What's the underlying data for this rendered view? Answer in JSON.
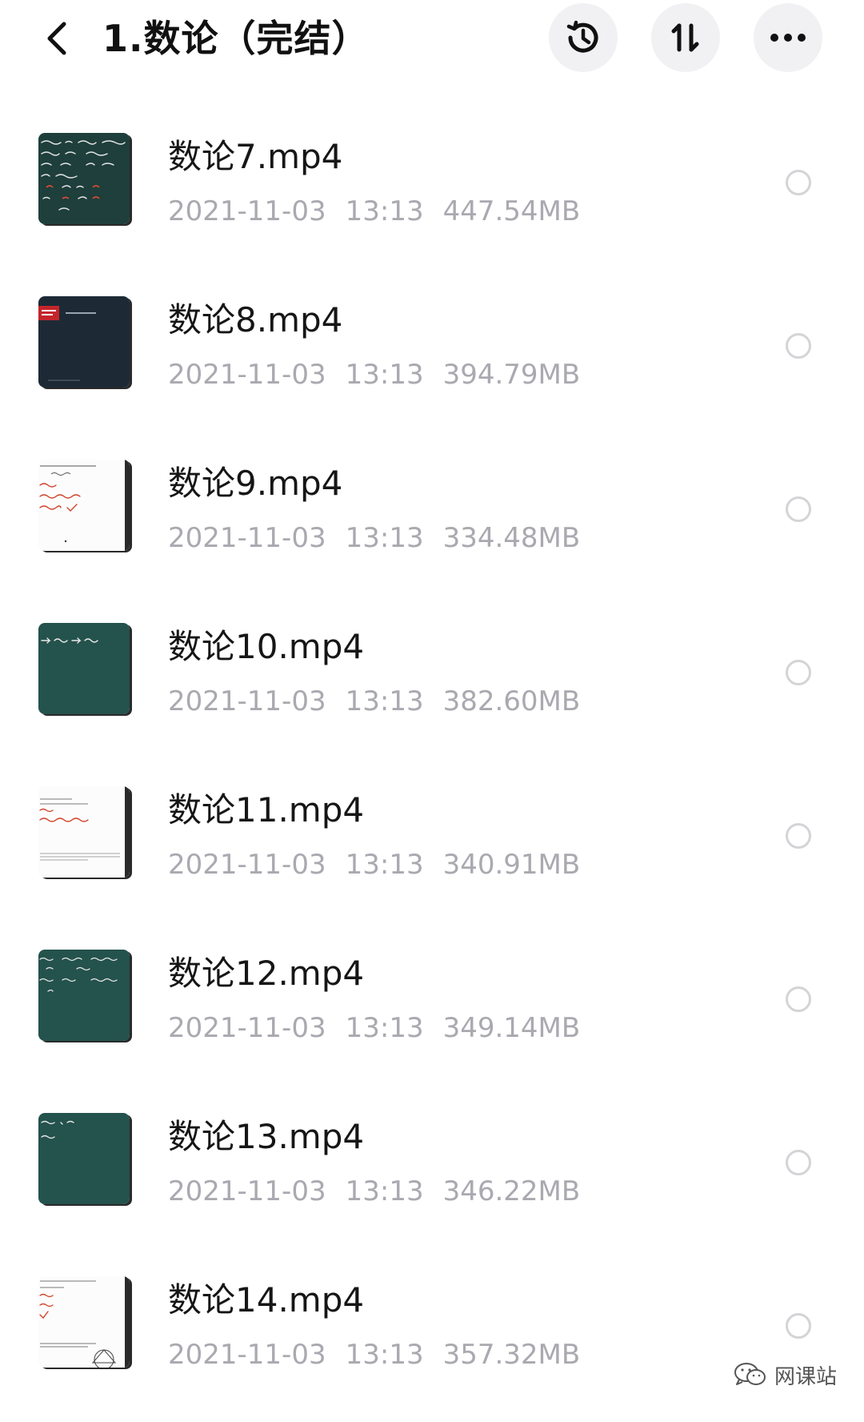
{
  "header": {
    "title": "1.数论（完结）",
    "icons": [
      "back-chevron-icon",
      "history-clock-icon",
      "sort-arrows-icon",
      "more-dots-icon"
    ]
  },
  "files": [
    {
      "name": "数论7.mp4",
      "date": "2021-11-03",
      "time": "13:13",
      "size": "447.54MB",
      "thumb": "chalkboard-dark"
    },
    {
      "name": "数论8.mp4",
      "date": "2021-11-03",
      "time": "13:13",
      "size": "394.79MB",
      "thumb": "title-slide"
    },
    {
      "name": "数论9.mp4",
      "date": "2021-11-03",
      "time": "13:13",
      "size": "334.48MB",
      "thumb": "whiteboard"
    },
    {
      "name": "数论10.mp4",
      "date": "2021-11-03",
      "time": "13:13",
      "size": "382.60MB",
      "thumb": "chalkboard-green"
    },
    {
      "name": "数论11.mp4",
      "date": "2021-11-03",
      "time": "13:13",
      "size": "340.91MB",
      "thumb": "whiteboard"
    },
    {
      "name": "数论12.mp4",
      "date": "2021-11-03",
      "time": "13:13",
      "size": "349.14MB",
      "thumb": "chalkboard-green"
    },
    {
      "name": "数论13.mp4",
      "date": "2021-11-03",
      "time": "13:13",
      "size": "346.22MB",
      "thumb": "chalkboard-green"
    },
    {
      "name": "数论14.mp4",
      "date": "2021-11-03",
      "time": "13:13",
      "size": "357.32MB",
      "thumb": "whiteboard"
    }
  ],
  "watermark": {
    "text": "网课站"
  },
  "colors": {
    "text": "#161616",
    "meta": "#a9a9b0",
    "button_bg": "#f1f1f3",
    "radio_border": "#d4d4d8",
    "chalkboard": "#1f4a45",
    "slide_dark": "#1d2a36",
    "accent_red": "#c4252b"
  }
}
